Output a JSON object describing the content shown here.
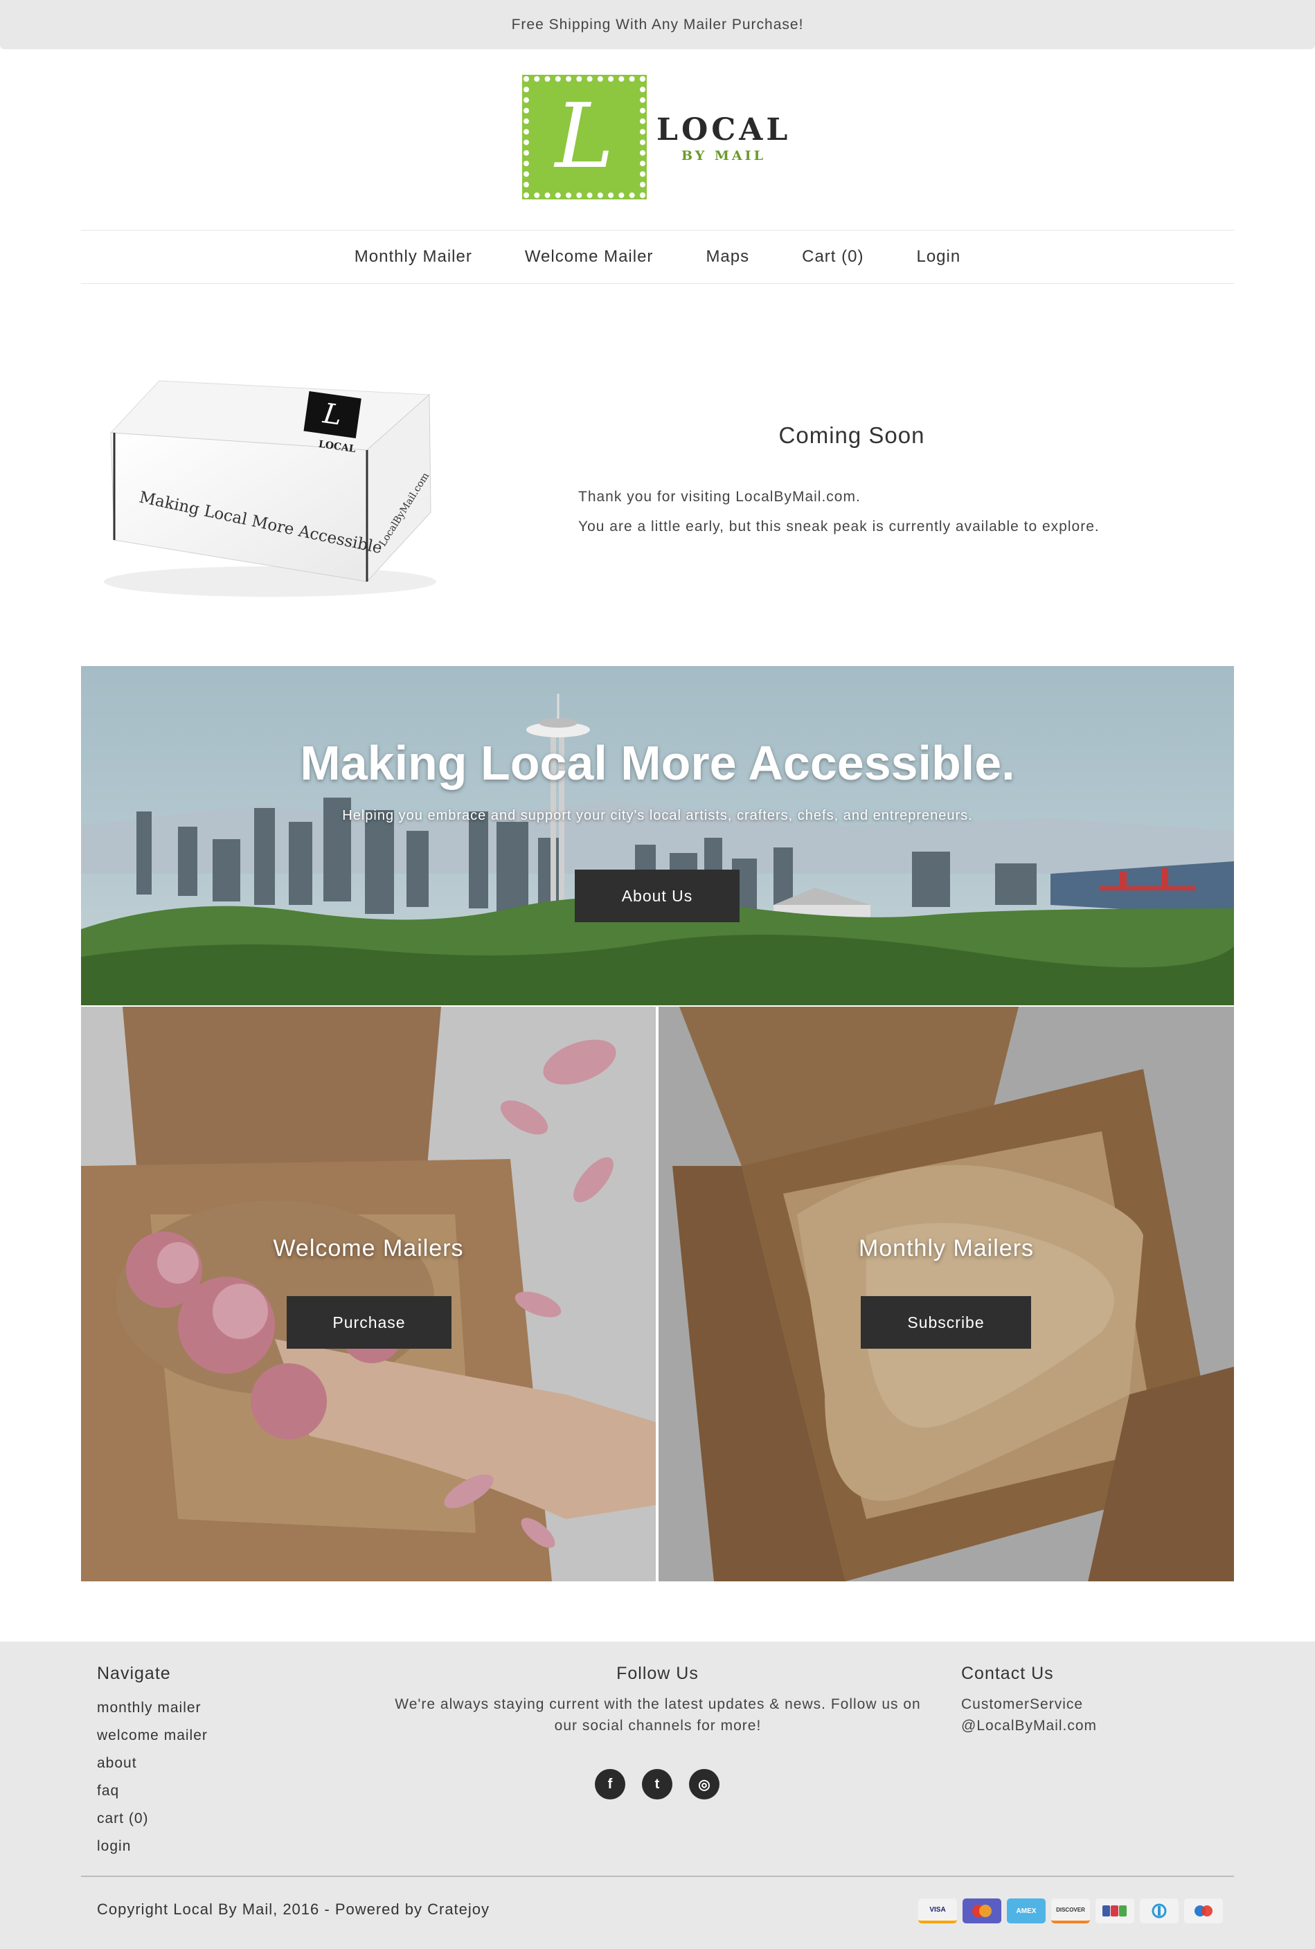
{
  "announcement": "Free Shipping With Any Mailer Purchase!",
  "logo": {
    "letter": "L",
    "word": "LOCAL",
    "sub": "BY MAIL"
  },
  "nav": [
    {
      "label": "Monthly Mailer"
    },
    {
      "label": "Welcome Mailer"
    },
    {
      "label": "Maps"
    },
    {
      "label": "Cart (0)"
    },
    {
      "label": "Login"
    }
  ],
  "intro": {
    "box_side_text": "Making Local More Accessible",
    "box_end_text": "LocalByMail.com",
    "title": "Coming Soon",
    "line1": "Thank you for visiting LocalByMail.com.",
    "line2": "You are a little early, but this sneak peak is currently available to explore."
  },
  "hero": {
    "title": "Making Local More Accessible.",
    "subtitle": "Helping you embrace and support your city's local artists, crafters, chefs, and entrepreneurs.",
    "button": "About Us"
  },
  "panels": {
    "welcome": {
      "title": "Welcome Mailers",
      "button": "Purchase"
    },
    "monthly": {
      "title": "Monthly Mailers",
      "button": "Subscribe"
    }
  },
  "footer": {
    "navigate_heading": "Navigate",
    "navigate_links": [
      "monthly mailer",
      "welcome mailer",
      "about",
      "faq",
      "cart (0)",
      "login"
    ],
    "follow_heading": "Follow Us",
    "follow_line1": "We're always staying current with the latest updates & news. Follow us on",
    "follow_line2": "our social channels for more!",
    "social": [
      {
        "name": "facebook-icon",
        "glyph": "f"
      },
      {
        "name": "twitter-icon",
        "glyph": "t"
      },
      {
        "name": "instagram-icon",
        "glyph": "◎"
      }
    ],
    "contact_heading": "Contact Us",
    "contact_line1": "CustomerService",
    "contact_line2": "@LocalByMail.com",
    "copyright": "Copyright Local By Mail, 2016 - Powered by Cratejoy",
    "payment_methods": [
      "VISA",
      "",
      "AMEX",
      "DISCOVER",
      "",
      "",
      ""
    ]
  },
  "colors": {
    "brand_green": "#8dc63f",
    "button_dark": "#2f2f2f",
    "footer_bg": "#e8e8e8"
  }
}
